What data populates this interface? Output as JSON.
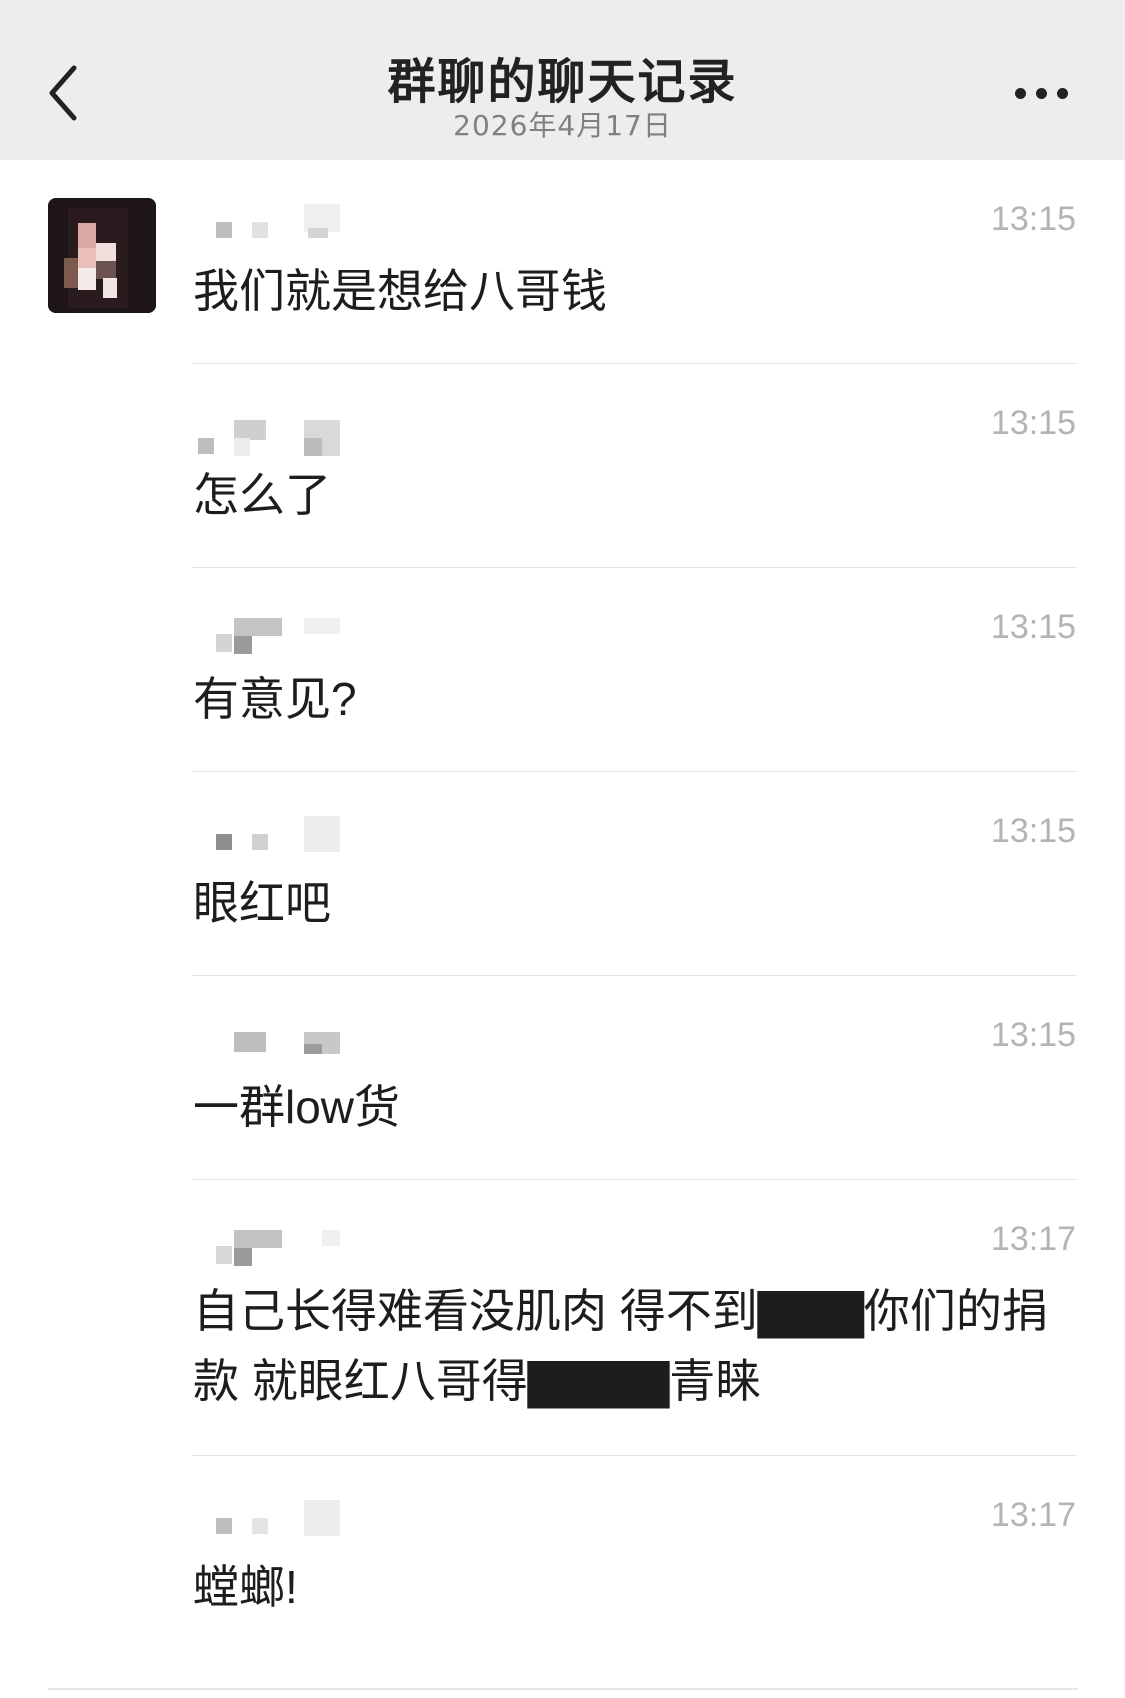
{
  "nav": {
    "title": "群聊的聊天记录",
    "date": "2026年4月17日",
    "back_icon": "chevron-left-icon",
    "more_icon": "more-dots-icon"
  },
  "messages": [
    {
      "time": "13:15",
      "text": "我们就是想给八哥钱"
    },
    {
      "time": "13:15",
      "text": "怎么了"
    },
    {
      "time": "13:15",
      "text": "有意见?"
    },
    {
      "time": "13:15",
      "text": "眼红吧"
    },
    {
      "time": "13:15",
      "text": "一群low货"
    },
    {
      "time": "13:17",
      "text": "自己长得难看没肌肉 得不到▇▇▇你们的捐款 就眼红八哥得▇▇▇▇青睐"
    },
    {
      "time": "13:17",
      "text": "螳螂!"
    }
  ]
}
